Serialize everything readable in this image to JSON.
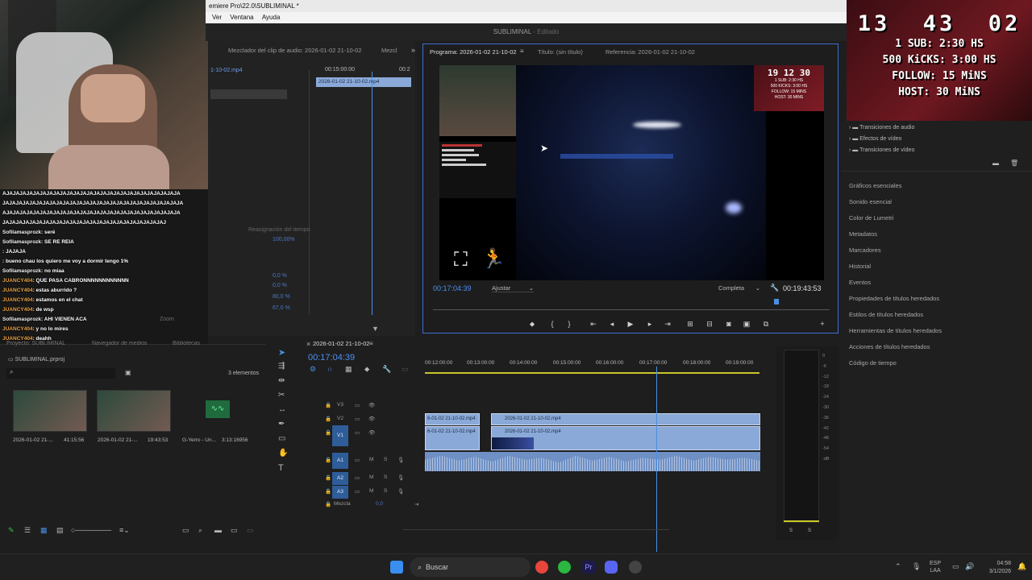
{
  "window": {
    "title": "emiere Pro\\22.0\\SUBLIMINAL *"
  },
  "menu": [
    "Ver",
    "Ventana",
    "Ayuda"
  ],
  "workspace": {
    "project": "SUBLIMINAL",
    "status": "Editado"
  },
  "effect_controls": {
    "tab1": "Mezclador del clip de audio: 2026-01-02 21-10-02",
    "tab2": "Mezcl",
    "clip_label": "1-10-02.mp4",
    "ruler_start": "00:15:00:00",
    "ruler_next": "00:2",
    "clip_bar": "2026-01-02 21-10-02.mp4",
    "remap_label": "Reasignación del tiempo",
    "opacity": "100,00%",
    "values": [
      "0,0 %",
      "0,0 %",
      "80,0 %",
      "67,0 %"
    ],
    "zoom": "Zoom"
  },
  "program_monitor": {
    "tab_program": "Programa: 2026-01-02 21-10-02",
    "tab_title": "Título: (sin título)",
    "tab_reference": "Referencia: 2026-01-02 21-10-02",
    "timecode": "00:17:04:39",
    "fit": "Ajustar",
    "quality": "Completa",
    "duration": "00:19:43:53",
    "playhead_fraction": 0.86
  },
  "overlay": {
    "clock": [
      "13",
      "43",
      "02"
    ],
    "lines": [
      "1 SUB: 2:30 HS",
      "500 KiCKS: 3:00 HS",
      "FOLLOW: 15 MiNS",
      "HOST: 30 MiNS"
    ],
    "mini_clock": "19 12 30",
    "mini_lines": [
      "1 SUB: 2:30 HS",
      "500 KICKS: 3:00 HS",
      "FOLLOW: 15 MINS",
      "HOST: 30 MINS"
    ]
  },
  "chat": [
    {
      "user": "",
      "text": "AJAJAJAJAJAJAJAJAJAJAJAJAJAJAJAJAJAJAJAJAJAJAJAJAJAJA"
    },
    {
      "user": "",
      "text": "JAJAJAJAJAJAJAJAJAJAJAJAJAJAJAJAJAJAJAJAJAJAJAJAJAJAJA"
    },
    {
      "user": "",
      "text": "AJAJAJAJAJAJAJAJAJAJAJAJAJAJAJAJAJAJAJAJAJAJAJAJAJAJA"
    },
    {
      "user": "",
      "text": "JAJAJAJAJAJAJAJAJAJAJAJAJAJAJAJAJAJAJAJAJAJAJAJAJ"
    },
    {
      "user": "Sofilamasprozk",
      "text": ": seré"
    },
    {
      "user": "Sofilamasprozk",
      "text": ": SE RE REIA"
    },
    {
      "user": "",
      "text": ": JAJAJA"
    },
    {
      "user": "",
      "text": ": bueno chau los quiero me voy a dormir tengo 1%"
    },
    {
      "user": "Sofilamasprozk",
      "text": ": no miaa"
    },
    {
      "user": "JUANCY404",
      "text": ": QUE PASA CABRONNNNNNNNNNNN"
    },
    {
      "user": "JUANCY404",
      "text": ": estas aburrido ?"
    },
    {
      "user": "JUANCY404",
      "text": ": estamos en el chat"
    },
    {
      "user": "JUANCY404",
      "text": ": de wsp"
    },
    {
      "user": "Sofilamasprozk",
      "text": ": AHI VIENEN ACA"
    },
    {
      "user": "JUANCY404",
      "text": ": y no lo mires"
    },
    {
      "user": "JUANCY404",
      "text": ": deahh"
    }
  ],
  "project": {
    "tabs": [
      "Proyecto: SUBLIMINAL",
      "Navegador de medios",
      "Bibliotecas"
    ],
    "file": "SUBLIMINAL.prproj",
    "count": "3 elementos",
    "items": [
      {
        "name": "2026-01-02 21-...",
        "duration": "41:15:56"
      },
      {
        "name": "2026-01-02 21-...",
        "duration": "19:43:53"
      },
      {
        "name": "G-Yerro - Un...",
        "duration": "3:13:16956"
      }
    ]
  },
  "timeline": {
    "sequence": "2026-01-02 21-10-02",
    "timecode": "00:17:04:39",
    "ruler": [
      "00:12:00:00",
      "00:13:00:00",
      "00:14:00:00",
      "00:15:00:00",
      "00:16:00:00",
      "00:17:00:00",
      "00:18:00:00",
      "00:19:00:00"
    ],
    "tracks_video": [
      "V3",
      "V2",
      "V1"
    ],
    "tracks_audio": [
      "A1",
      "A2",
      "A3"
    ],
    "mix_label": "Mezcla",
    "mix_value": "0,0",
    "clip_a": "6-01-02 21-10-02.mp4",
    "clip_b": "2026-01-02 21-10-02.mp4",
    "playhead_fraction": 0.69
  },
  "right_panel": {
    "tree": [
      "Transiciones de audio",
      "Efectos de vídeo",
      "Transiciones de vídeo"
    ],
    "items": [
      "Gráficos esenciales",
      "Sonido esencial",
      "Color de Lumetri",
      "Metadatos",
      "Marcadores",
      "Historial",
      "Eventos",
      "Propiedades de títulos heredados",
      "Estilos de títulos heredados",
      "Herramientas de títulos heredados",
      "Acciones de títulos heredados",
      "Código de tiempo"
    ]
  },
  "meter": {
    "scale": [
      "0",
      "-6",
      "-12",
      "-18",
      "-24",
      "-30",
      "-36",
      "-42",
      "-48",
      "-54",
      "-dB"
    ],
    "solo": [
      "S",
      "S"
    ]
  },
  "taskbar": {
    "search": "Buscar",
    "lang1": "ESP",
    "lang2": "LAA",
    "time": "04:58",
    "date": "3/1/2026"
  },
  "colors": {
    "accent": "#3d6fd1",
    "clip_video": "#8aa9d8",
    "clip_audio": "#6f90c4",
    "playhead": "#4a90e2"
  }
}
